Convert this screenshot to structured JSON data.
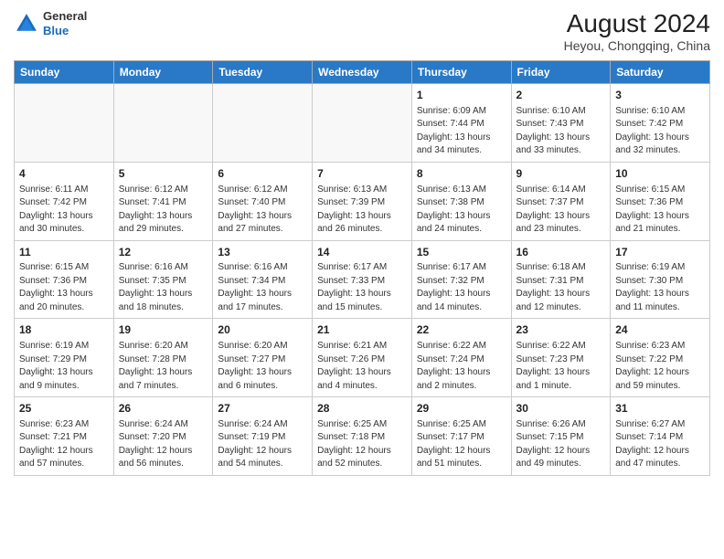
{
  "header": {
    "logo": {
      "general": "General",
      "blue": "Blue"
    },
    "month_year": "August 2024",
    "location": "Heyou, Chongqing, China"
  },
  "days_of_week": [
    "Sunday",
    "Monday",
    "Tuesday",
    "Wednesday",
    "Thursday",
    "Friday",
    "Saturday"
  ],
  "weeks": [
    [
      {
        "day": "",
        "sunrise": "",
        "sunset": "",
        "daylight": ""
      },
      {
        "day": "",
        "sunrise": "",
        "sunset": "",
        "daylight": ""
      },
      {
        "day": "",
        "sunrise": "",
        "sunset": "",
        "daylight": ""
      },
      {
        "day": "",
        "sunrise": "",
        "sunset": "",
        "daylight": ""
      },
      {
        "day": "1",
        "sunrise": "Sunrise: 6:09 AM",
        "sunset": "Sunset: 7:44 PM",
        "daylight": "Daylight: 13 hours and 34 minutes."
      },
      {
        "day": "2",
        "sunrise": "Sunrise: 6:10 AM",
        "sunset": "Sunset: 7:43 PM",
        "daylight": "Daylight: 13 hours and 33 minutes."
      },
      {
        "day": "3",
        "sunrise": "Sunrise: 6:10 AM",
        "sunset": "Sunset: 7:42 PM",
        "daylight": "Daylight: 13 hours and 32 minutes."
      }
    ],
    [
      {
        "day": "4",
        "sunrise": "Sunrise: 6:11 AM",
        "sunset": "Sunset: 7:42 PM",
        "daylight": "Daylight: 13 hours and 30 minutes."
      },
      {
        "day": "5",
        "sunrise": "Sunrise: 6:12 AM",
        "sunset": "Sunset: 7:41 PM",
        "daylight": "Daylight: 13 hours and 29 minutes."
      },
      {
        "day": "6",
        "sunrise": "Sunrise: 6:12 AM",
        "sunset": "Sunset: 7:40 PM",
        "daylight": "Daylight: 13 hours and 27 minutes."
      },
      {
        "day": "7",
        "sunrise": "Sunrise: 6:13 AM",
        "sunset": "Sunset: 7:39 PM",
        "daylight": "Daylight: 13 hours and 26 minutes."
      },
      {
        "day": "8",
        "sunrise": "Sunrise: 6:13 AM",
        "sunset": "Sunset: 7:38 PM",
        "daylight": "Daylight: 13 hours and 24 minutes."
      },
      {
        "day": "9",
        "sunrise": "Sunrise: 6:14 AM",
        "sunset": "Sunset: 7:37 PM",
        "daylight": "Daylight: 13 hours and 23 minutes."
      },
      {
        "day": "10",
        "sunrise": "Sunrise: 6:15 AM",
        "sunset": "Sunset: 7:36 PM",
        "daylight": "Daylight: 13 hours and 21 minutes."
      }
    ],
    [
      {
        "day": "11",
        "sunrise": "Sunrise: 6:15 AM",
        "sunset": "Sunset: 7:36 PM",
        "daylight": "Daylight: 13 hours and 20 minutes."
      },
      {
        "day": "12",
        "sunrise": "Sunrise: 6:16 AM",
        "sunset": "Sunset: 7:35 PM",
        "daylight": "Daylight: 13 hours and 18 minutes."
      },
      {
        "day": "13",
        "sunrise": "Sunrise: 6:16 AM",
        "sunset": "Sunset: 7:34 PM",
        "daylight": "Daylight: 13 hours and 17 minutes."
      },
      {
        "day": "14",
        "sunrise": "Sunrise: 6:17 AM",
        "sunset": "Sunset: 7:33 PM",
        "daylight": "Daylight: 13 hours and 15 minutes."
      },
      {
        "day": "15",
        "sunrise": "Sunrise: 6:17 AM",
        "sunset": "Sunset: 7:32 PM",
        "daylight": "Daylight: 13 hours and 14 minutes."
      },
      {
        "day": "16",
        "sunrise": "Sunrise: 6:18 AM",
        "sunset": "Sunset: 7:31 PM",
        "daylight": "Daylight: 13 hours and 12 minutes."
      },
      {
        "day": "17",
        "sunrise": "Sunrise: 6:19 AM",
        "sunset": "Sunset: 7:30 PM",
        "daylight": "Daylight: 13 hours and 11 minutes."
      }
    ],
    [
      {
        "day": "18",
        "sunrise": "Sunrise: 6:19 AM",
        "sunset": "Sunset: 7:29 PM",
        "daylight": "Daylight: 13 hours and 9 minutes."
      },
      {
        "day": "19",
        "sunrise": "Sunrise: 6:20 AM",
        "sunset": "Sunset: 7:28 PM",
        "daylight": "Daylight: 13 hours and 7 minutes."
      },
      {
        "day": "20",
        "sunrise": "Sunrise: 6:20 AM",
        "sunset": "Sunset: 7:27 PM",
        "daylight": "Daylight: 13 hours and 6 minutes."
      },
      {
        "day": "21",
        "sunrise": "Sunrise: 6:21 AM",
        "sunset": "Sunset: 7:26 PM",
        "daylight": "Daylight: 13 hours and 4 minutes."
      },
      {
        "day": "22",
        "sunrise": "Sunrise: 6:22 AM",
        "sunset": "Sunset: 7:24 PM",
        "daylight": "Daylight: 13 hours and 2 minutes."
      },
      {
        "day": "23",
        "sunrise": "Sunrise: 6:22 AM",
        "sunset": "Sunset: 7:23 PM",
        "daylight": "Daylight: 13 hours and 1 minute."
      },
      {
        "day": "24",
        "sunrise": "Sunrise: 6:23 AM",
        "sunset": "Sunset: 7:22 PM",
        "daylight": "Daylight: 12 hours and 59 minutes."
      }
    ],
    [
      {
        "day": "25",
        "sunrise": "Sunrise: 6:23 AM",
        "sunset": "Sunset: 7:21 PM",
        "daylight": "Daylight: 12 hours and 57 minutes."
      },
      {
        "day": "26",
        "sunrise": "Sunrise: 6:24 AM",
        "sunset": "Sunset: 7:20 PM",
        "daylight": "Daylight: 12 hours and 56 minutes."
      },
      {
        "day": "27",
        "sunrise": "Sunrise: 6:24 AM",
        "sunset": "Sunset: 7:19 PM",
        "daylight": "Daylight: 12 hours and 54 minutes."
      },
      {
        "day": "28",
        "sunrise": "Sunrise: 6:25 AM",
        "sunset": "Sunset: 7:18 PM",
        "daylight": "Daylight: 12 hours and 52 minutes."
      },
      {
        "day": "29",
        "sunrise": "Sunrise: 6:25 AM",
        "sunset": "Sunset: 7:17 PM",
        "daylight": "Daylight: 12 hours and 51 minutes."
      },
      {
        "day": "30",
        "sunrise": "Sunrise: 6:26 AM",
        "sunset": "Sunset: 7:15 PM",
        "daylight": "Daylight: 12 hours and 49 minutes."
      },
      {
        "day": "31",
        "sunrise": "Sunrise: 6:27 AM",
        "sunset": "Sunset: 7:14 PM",
        "daylight": "Daylight: 12 hours and 47 minutes."
      }
    ]
  ]
}
